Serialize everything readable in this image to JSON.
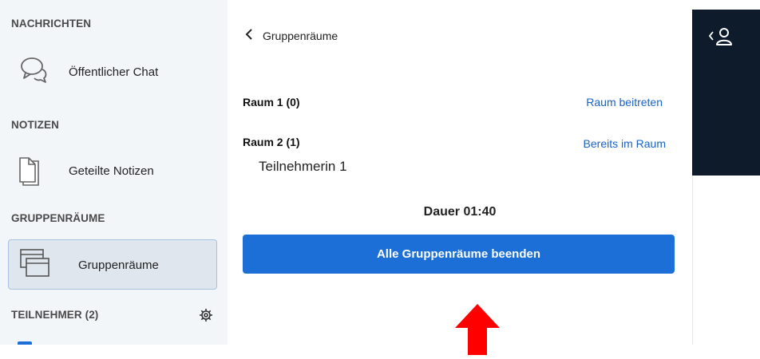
{
  "sidebar": {
    "sections": {
      "messages": "NACHRICHTEN",
      "notes": "NOTIZEN",
      "breakout": "GRUPPENRÄUME",
      "participants": "TEILNEHMER (2)"
    },
    "items": {
      "public_chat": "Öffentlicher Chat",
      "shared_notes": "Geteilte Notizen",
      "breakout_rooms": "Gruppenräume"
    }
  },
  "panel": {
    "back_label": "Gruppenräume",
    "rooms": [
      {
        "name": "Raum 1 (0)",
        "action": "Raum beitreten",
        "participants": []
      },
      {
        "name": "Raum 2 (1)",
        "action": "Bereits im Raum",
        "participants": [
          "Teilnehmerin 1"
        ]
      }
    ],
    "duration": "Dauer 01:40",
    "end_button": "Alle Gruppenräume beenden"
  },
  "icons": {
    "chat": "chat-bubbles-icon",
    "notes": "document-icon",
    "breakout": "windows-icon",
    "settings": "gear-icon",
    "user": "user-icon",
    "back": "chevron-left-icon"
  },
  "colors": {
    "accent": "#1b6fd6",
    "link": "#1a62c7",
    "sidebar_bg": "#f3f6f9",
    "dark_bar": "#0d1b2a",
    "annotation_arrow": "#ff0000"
  }
}
